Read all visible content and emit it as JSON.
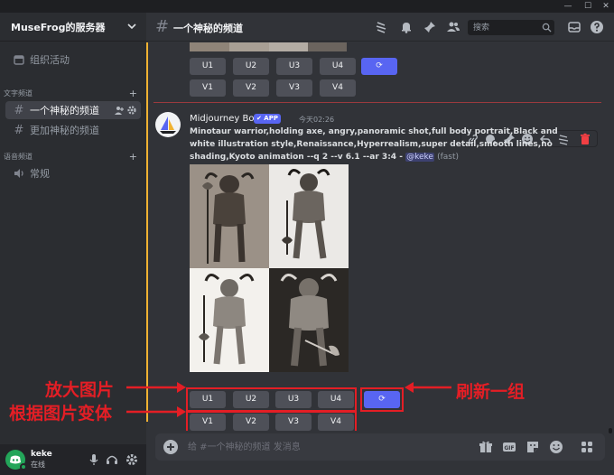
{
  "window": {
    "minimize": "—",
    "maximize": "☐",
    "close": "✕"
  },
  "server": {
    "name": "MuseFrog的服务器"
  },
  "sidebar": {
    "events": "组织活动",
    "text_category": "文字频道",
    "channels": [
      {
        "name": "一个神秘的频道",
        "active": true
      },
      {
        "name": "更加神秘的频道",
        "active": false
      }
    ],
    "voice_category": "语音频道",
    "voice_channels": [
      {
        "name": "常规"
      }
    ]
  },
  "user": {
    "name": "keke",
    "status": "在线"
  },
  "header": {
    "channel": "一个神秘的频道",
    "search_placeholder": "搜索"
  },
  "message": {
    "bot_name": "Midjourney Bot",
    "app_badge": "✔ APP",
    "timestamp": "今天02:26",
    "prompt": "Minotaur warrior,holding axe, angry,panoramic shot,full body portrait,Black and white illustration style,Renaissance,Hyperrealism,super detail,smooth lines,no shading,Kyoto animation --q 2 --v 6.1 --ar 3:4 -",
    "mention": "@keke",
    "speed": "(fast)"
  },
  "buttons": {
    "upscale": [
      "U1",
      "U2",
      "U3",
      "U4"
    ],
    "variation": [
      "V1",
      "V2",
      "V3",
      "V4"
    ],
    "refresh": "⟳"
  },
  "annotations": {
    "upscale": "放大图片",
    "variation": "根据图片变体",
    "refresh": "刷新一组"
  },
  "composer": {
    "placeholder": "给 #一个神秘的频道 发消息"
  },
  "colors": {
    "accent": "#5865f2",
    "highlight": "#e41e25",
    "mention_bar": "#f0b232"
  }
}
